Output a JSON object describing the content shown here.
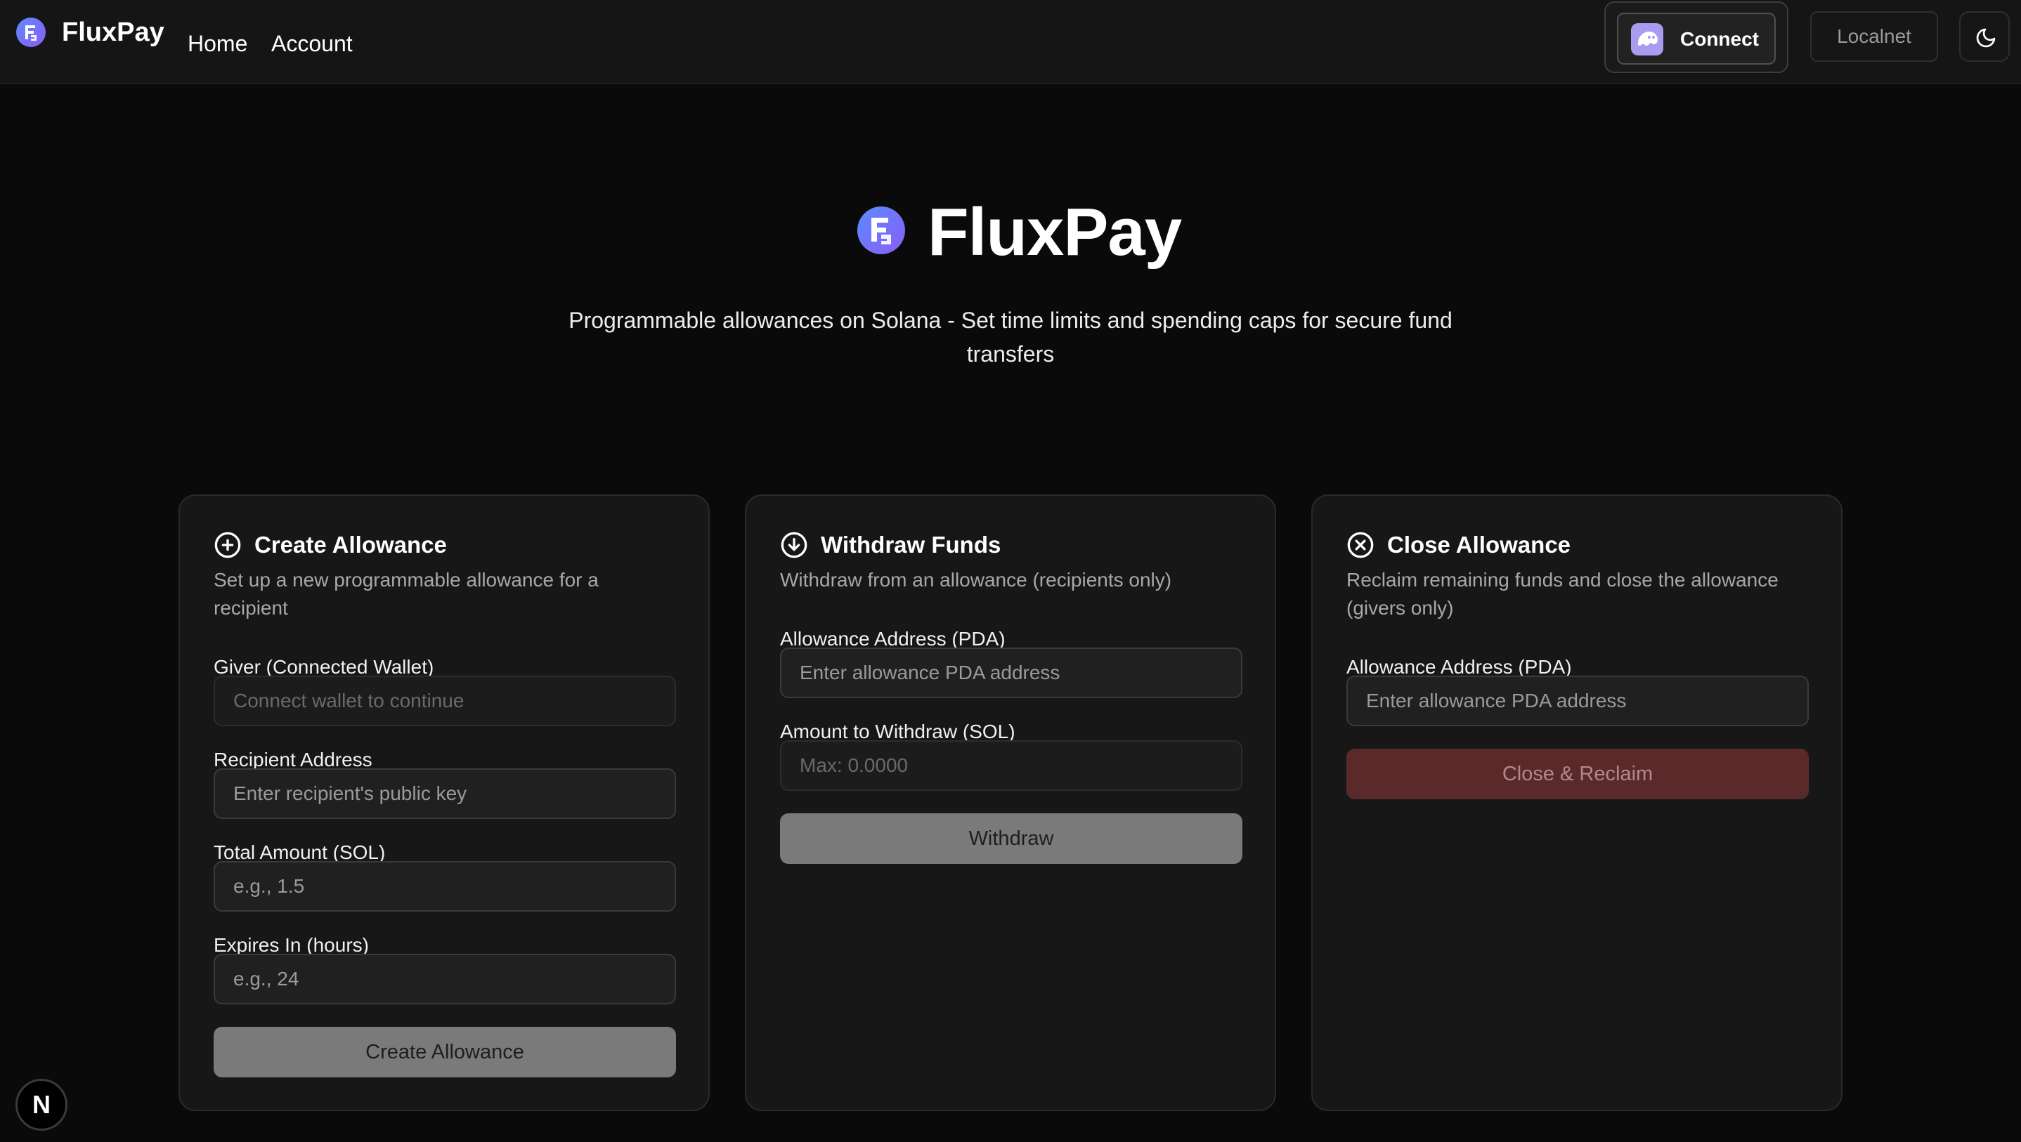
{
  "app": {
    "name": "FluxPay"
  },
  "nav": {
    "links": [
      "Home",
      "Account"
    ],
    "connect_label": "Connect",
    "network_label": "Localnet"
  },
  "hero": {
    "title": "FluxPay",
    "description": "Programmable allowances on Solana - Set time limits and spending caps for secure fund transfers"
  },
  "cards": {
    "create": {
      "title": "Create Allowance",
      "description": "Set up a new programmable allowance for a recipient",
      "icon": "plus-circle-icon",
      "fields": [
        {
          "label": "Giver (Connected Wallet)",
          "placeholder": "Connect wallet to continue"
        },
        {
          "label": "Recipient Address",
          "placeholder": "Enter recipient's public key"
        },
        {
          "label": "Total Amount (SOL)",
          "placeholder": "e.g., 1.5"
        },
        {
          "label": "Expires In (hours)",
          "placeholder": "e.g., 24"
        }
      ],
      "button": "Create Allowance"
    },
    "withdraw": {
      "title": "Withdraw Funds",
      "description": "Withdraw from an allowance (recipients only)",
      "icon": "arrow-down-circle-icon",
      "fields": [
        {
          "label": "Allowance Address (PDA)",
          "placeholder": "Enter allowance PDA address"
        },
        {
          "label": "Amount to Withdraw (SOL)",
          "placeholder": "Max: 0.0000"
        }
      ],
      "button": "Withdraw"
    },
    "close": {
      "title": "Close Allowance",
      "description": "Reclaim remaining funds and close the allowance (givers only)",
      "icon": "x-circle-icon",
      "fields": [
        {
          "label": "Allowance Address (PDA)",
          "placeholder": "Enter allowance PDA address"
        }
      ],
      "button": "Close & Reclaim"
    }
  },
  "dev_badge": {
    "label": "N"
  },
  "colors": {
    "background": "#0a0a0a",
    "card": "#171717",
    "logo_gradient_start": "#5b8cff",
    "logo_gradient_end": "#8a5cf6",
    "danger_button": "#5a2a2a"
  }
}
